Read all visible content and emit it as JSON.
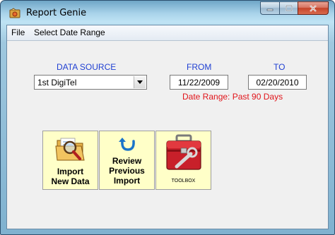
{
  "window": {
    "title": "Report Genie"
  },
  "menu": {
    "items": [
      "File",
      "Select Date Range"
    ]
  },
  "form": {
    "data_source_label": "DATA SOURCE",
    "data_source_value": "1st DigiTel",
    "from_label": "FROM",
    "from_value": "11/22/2009",
    "to_label": "TO",
    "to_value": "02/20/2010",
    "date_range_text": "Date Range:  Past 90 Days"
  },
  "buttons": {
    "import": {
      "line1": "Import",
      "line2": "New Data"
    },
    "review": {
      "line1": "Review",
      "line2": "Previous",
      "line3": "Import"
    },
    "toolbox": {
      "label": "TOOLBOX"
    }
  },
  "icons": {
    "app": "report-genie-icon",
    "import": "folder-search-icon",
    "review": "undo-arrow-icon",
    "toolbox": "toolbox-icon"
  },
  "colors": {
    "label_blue": "#1f3fd2",
    "date_range_red": "#e1141a",
    "button_bg": "#ffffc8",
    "client_bg": "#f0f0f0"
  }
}
